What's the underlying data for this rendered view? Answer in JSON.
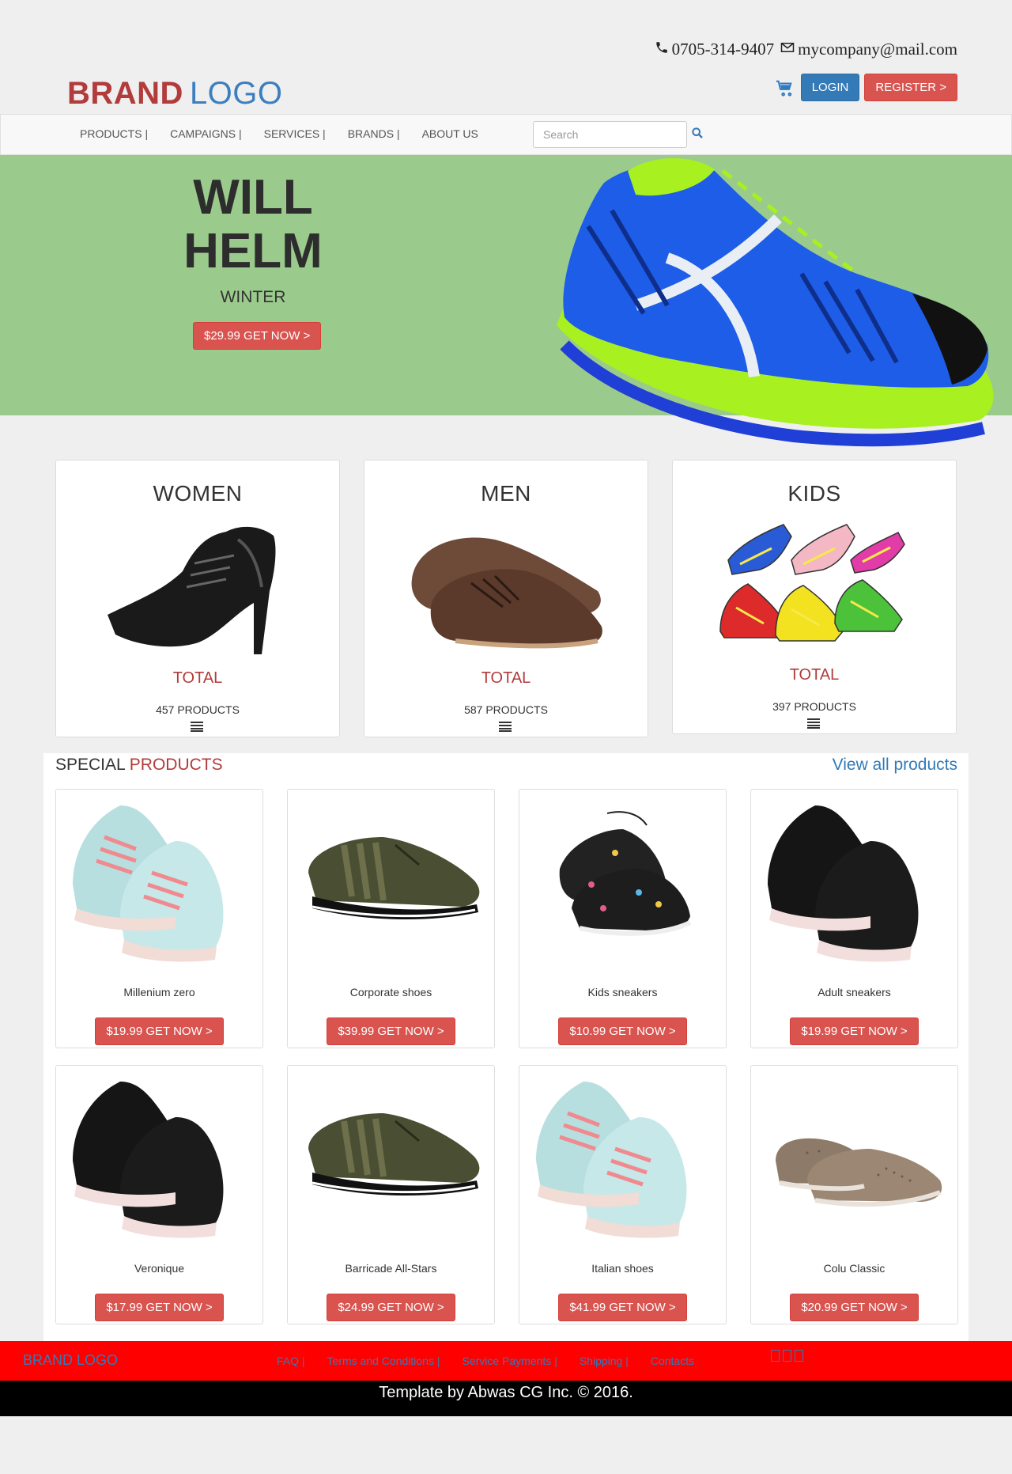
{
  "contact": {
    "phone": "0705-314-9407",
    "email": "mycompany@mail.com"
  },
  "brand": {
    "part1": "BRAND",
    "part2": "LOGO"
  },
  "header": {
    "login": "LOGIN",
    "register": "REGISTER >"
  },
  "nav": {
    "items": [
      "PRODUCTS |",
      "CAMPAIGNS |",
      "SERVICES |",
      "BRANDS |",
      "ABOUT US"
    ],
    "search_placeholder": "Search"
  },
  "hero": {
    "title": "WILL HELM",
    "subtitle": "WINTER",
    "button": "$29.99 GET NOW >"
  },
  "categories": [
    {
      "name": "WOMEN",
      "total": "TOTAL",
      "count": "457 PRODUCTS"
    },
    {
      "name": "MEN",
      "total": "TOTAL",
      "count": "587 PRODUCTS"
    },
    {
      "name": "KIDS",
      "total": "TOTAL",
      "count": "397 PRODUCTS"
    }
  ],
  "special": {
    "title_a": "SPECIAL",
    "title_b": "PRODUCTS",
    "view_all": "View all products",
    "products": [
      {
        "name": "Millenium zero",
        "button": "$19.99 GET NOW >"
      },
      {
        "name": "Corporate shoes",
        "button": "$39.99 GET NOW >"
      },
      {
        "name": "Kids sneakers",
        "button": "$10.99 GET NOW >"
      },
      {
        "name": "Adult sneakers",
        "button": "$19.99 GET NOW >"
      },
      {
        "name": "Veronique",
        "button": "$17.99 GET NOW >"
      },
      {
        "name": "Barricade All-Stars",
        "button": "$24.99 GET NOW >"
      },
      {
        "name": "Italian shoes",
        "button": "$41.99 GET NOW >"
      },
      {
        "name": "Colu Classic",
        "button": "$20.99 GET NOW >"
      }
    ]
  },
  "footer": {
    "logo": "BRAND LOGO",
    "links": [
      "FAQ |",
      "Terms and Conditions |",
      "Service Payments |",
      "Shipping |",
      "Contacts"
    ],
    "copyright": "Template by Abwas CG Inc. © 2016."
  }
}
